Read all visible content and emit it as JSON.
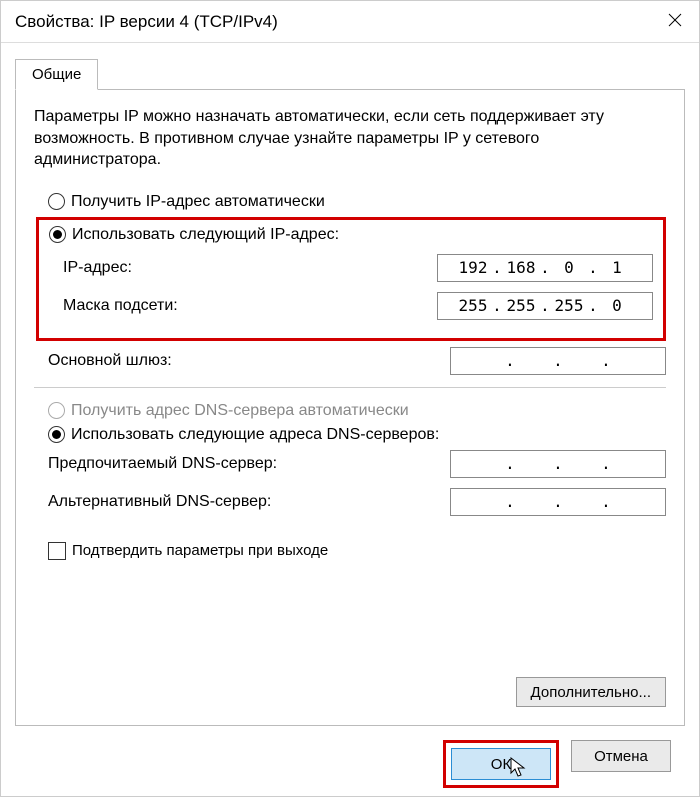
{
  "title": "Свойства: IP версии 4 (TCP/IPv4)",
  "tab": {
    "general": "Общие"
  },
  "description": "Параметры IP можно назначать автоматически, если сеть поддерживает эту возможность. В противном случае узнайте параметры IP у сетевого администратора.",
  "ip_section": {
    "auto_label": "Получить IP-адрес автоматически",
    "use_label": "Использовать следующий IP-адрес:",
    "ip_label": "IP-адрес:",
    "mask_label": "Маска подсети:",
    "gateway_label": "Основной шлюз:",
    "ip": {
      "o1": "192",
      "o2": "168",
      "o3": "0",
      "o4": "1"
    },
    "mask": {
      "o1": "255",
      "o2": "255",
      "o3": "255",
      "o4": "0"
    },
    "gateway": {
      "o1": "",
      "o2": "",
      "o3": "",
      "o4": ""
    }
  },
  "dns_section": {
    "auto_label": "Получить адрес DNS-сервера автоматически",
    "use_label": "Использовать следующие адреса DNS-серверов:",
    "preferred_label": "Предпочитаемый DNS-сервер:",
    "alternate_label": "Альтернативный DNS-сервер:",
    "preferred": {
      "o1": "",
      "o2": "",
      "o3": "",
      "o4": ""
    },
    "alternate": {
      "o1": "",
      "o2": "",
      "o3": "",
      "o4": ""
    }
  },
  "validate_label": "Подтвердить параметры при выходе",
  "advanced_label": "Дополнительно...",
  "buttons": {
    "ok": "ОК",
    "cancel": "Отмена"
  },
  "dot": "."
}
